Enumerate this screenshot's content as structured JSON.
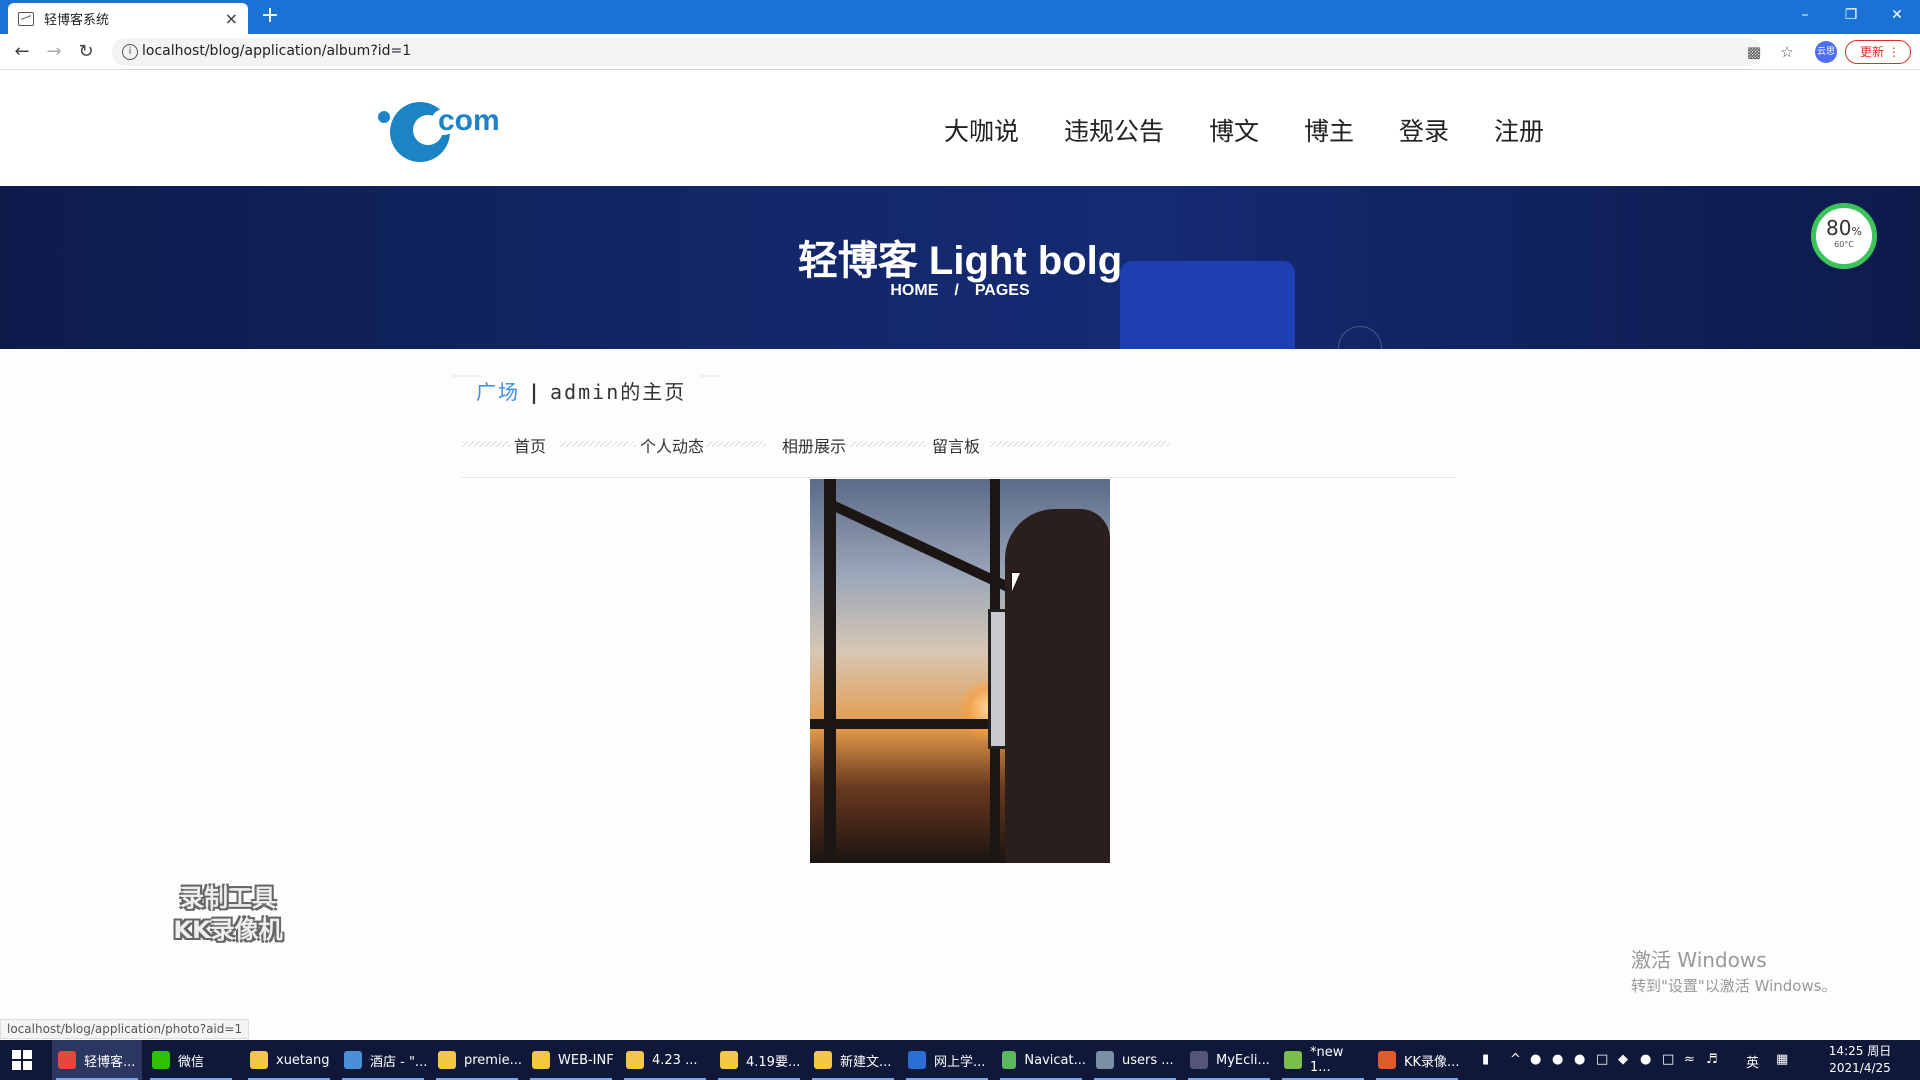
{
  "browser": {
    "tab_title": "轻博客系统",
    "tab_close": "×",
    "new_tab": "+",
    "url": "localhost/blog/application/album?id=1",
    "update_label": "更新",
    "profile_label": "云思",
    "status_link": "localhost/blog/application/photo?aid=1"
  },
  "header": {
    "logo_text": "com",
    "nav": [
      "大咖说",
      "违规公告",
      "博文",
      "博主",
      "登录",
      "注册"
    ]
  },
  "banner": {
    "title": "轻博客 Light bolg",
    "crumb_home": "HOME",
    "crumb_sep": "/",
    "crumb_pages": "PAGES"
  },
  "gauge": {
    "percent": "80",
    "unit": "%",
    "temp": "60°C"
  },
  "content": {
    "square_link": "广场",
    "separator": "|",
    "user_home": "admin的主页",
    "subnav": [
      "首页",
      "个人动态",
      "相册展示",
      "留言板"
    ]
  },
  "overlay": {
    "recorder_line1": "录制工具",
    "recorder_line2": "KK录像机",
    "activate_title": "激活 Windows",
    "activate_hint": "转到\"设置\"以激活 Windows。"
  },
  "taskbar": {
    "items": [
      {
        "label": "轻博客...",
        "color": "#e8453c"
      },
      {
        "label": "微信",
        "color": "#2dc100"
      },
      {
        "label": "xuetang",
        "color": "#f3c744"
      },
      {
        "label": "酒店 - \"...",
        "color": "#4a90d9"
      },
      {
        "label": "premie...",
        "color": "#f3c744"
      },
      {
        "label": "WEB-INF",
        "color": "#f3c744"
      },
      {
        "label": "4.23 ...",
        "color": "#f3c744"
      },
      {
        "label": "4.19要...",
        "color": "#f3c744"
      },
      {
        "label": "新建文...",
        "color": "#f3c744"
      },
      {
        "label": "网上学...",
        "color": "#2a6fd6"
      },
      {
        "label": "Navicat...",
        "color": "#5cb85c"
      },
      {
        "label": "users ...",
        "color": "#7a8fa6"
      },
      {
        "label": "MyEcli...",
        "color": "#555577"
      },
      {
        "label": "*new 1...",
        "color": "#7bbf4a"
      },
      {
        "label": "KK录像...",
        "color": "#e05a2a"
      }
    ],
    "ime": "英",
    "time": "14:25 周日",
    "date": "2021/4/25"
  }
}
